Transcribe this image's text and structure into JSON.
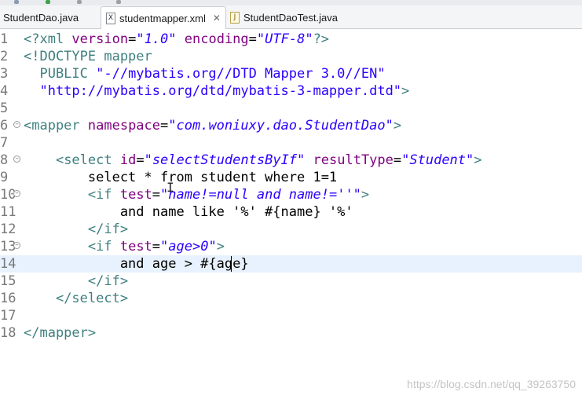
{
  "tabs": [
    {
      "label": "StudentDao.java",
      "icon": "java-file-icon",
      "active": false
    },
    {
      "label": "studentmapper.xml",
      "icon": "xml-file-icon",
      "active": true
    },
    {
      "label": "StudentDaoTest.java",
      "icon": "java-file-icon",
      "active": false
    }
  ],
  "colors": {
    "tag": "#3f7f7f",
    "attribute": "#7f007f",
    "string": "#2a00ff",
    "current_line": "#e8f2fe"
  },
  "lines": [
    {
      "num": "1",
      "fold": false,
      "tokens": [
        [
          "pi",
          "<?xml "
        ],
        [
          "attr",
          "version"
        ],
        [
          "txt",
          "="
        ],
        [
          "val",
          "\"1.0\""
        ],
        [
          "txt",
          " "
        ],
        [
          "attr",
          "encoding"
        ],
        [
          "txt",
          "="
        ],
        [
          "val",
          "\"UTF-8\""
        ],
        [
          "pi",
          "?>"
        ]
      ]
    },
    {
      "num": "2",
      "fold": false,
      "tokens": [
        [
          "doc",
          "<!DOCTYPE mapper"
        ]
      ]
    },
    {
      "num": "3",
      "fold": false,
      "tokens": [
        [
          "doc",
          "  PUBLIC "
        ],
        [
          "docstr",
          "\"-//mybatis.org//DTD Mapper 3.0//EN\""
        ]
      ]
    },
    {
      "num": "4",
      "fold": false,
      "tokens": [
        [
          "docstr",
          "  \"http://mybatis.org/dtd/mybatis-3-mapper.dtd\""
        ],
        [
          "doc",
          ">"
        ]
      ]
    },
    {
      "num": "5",
      "fold": false,
      "tokens": []
    },
    {
      "num": "6",
      "fold": true,
      "tokens": [
        [
          "tag",
          "<mapper "
        ],
        [
          "attr",
          "namespace"
        ],
        [
          "txt",
          "="
        ],
        [
          "val",
          "\"com.woniuxy.dao.StudentDao\""
        ],
        [
          "tag",
          ">"
        ]
      ]
    },
    {
      "num": "7",
      "fold": false,
      "tokens": []
    },
    {
      "num": "8",
      "fold": true,
      "tokens": [
        [
          "txt",
          "    "
        ],
        [
          "tag",
          "<select "
        ],
        [
          "attr",
          "id"
        ],
        [
          "txt",
          "="
        ],
        [
          "val",
          "\"selectStudentsByIf\""
        ],
        [
          "txt",
          " "
        ],
        [
          "attr",
          "resultType"
        ],
        [
          "txt",
          "="
        ],
        [
          "val",
          "\"Student\""
        ],
        [
          "tag",
          ">"
        ]
      ]
    },
    {
      "num": "9",
      "fold": false,
      "tokens": [
        [
          "txt",
          "        select * from student where 1=1"
        ]
      ]
    },
    {
      "num": "10",
      "fold": true,
      "tokens": [
        [
          "txt",
          "        "
        ],
        [
          "tag",
          "<if "
        ],
        [
          "attr",
          "test"
        ],
        [
          "txt",
          "="
        ],
        [
          "val",
          "\"name!=null and name!=''\""
        ],
        [
          "tag",
          ">"
        ]
      ]
    },
    {
      "num": "11",
      "fold": false,
      "tokens": [
        [
          "txt",
          "            and name like '%' #{name} '%'"
        ]
      ]
    },
    {
      "num": "12",
      "fold": false,
      "tokens": [
        [
          "txt",
          "        "
        ],
        [
          "tag",
          "</if>"
        ]
      ]
    },
    {
      "num": "13",
      "fold": true,
      "tokens": [
        [
          "txt",
          "        "
        ],
        [
          "tag",
          "<if "
        ],
        [
          "attr",
          "test"
        ],
        [
          "txt",
          "="
        ],
        [
          "val",
          "\"age>0\""
        ],
        [
          "tag",
          ">"
        ]
      ]
    },
    {
      "num": "14",
      "fold": false,
      "current": true,
      "tokens": [
        [
          "txt",
          "            and age > #{age}"
        ]
      ]
    },
    {
      "num": "15",
      "fold": false,
      "tokens": [
        [
          "txt",
          "        "
        ],
        [
          "tag",
          "</if>"
        ]
      ]
    },
    {
      "num": "16",
      "fold": false,
      "tokens": [
        [
          "txt",
          "    "
        ],
        [
          "tag",
          "</select>"
        ]
      ]
    },
    {
      "num": "17",
      "fold": false,
      "tokens": []
    },
    {
      "num": "18",
      "fold": false,
      "tokens": [
        [
          "tag",
          "</mapper>"
        ]
      ]
    }
  ],
  "watermark": "https://blog.csdn.net/qq_39263750"
}
